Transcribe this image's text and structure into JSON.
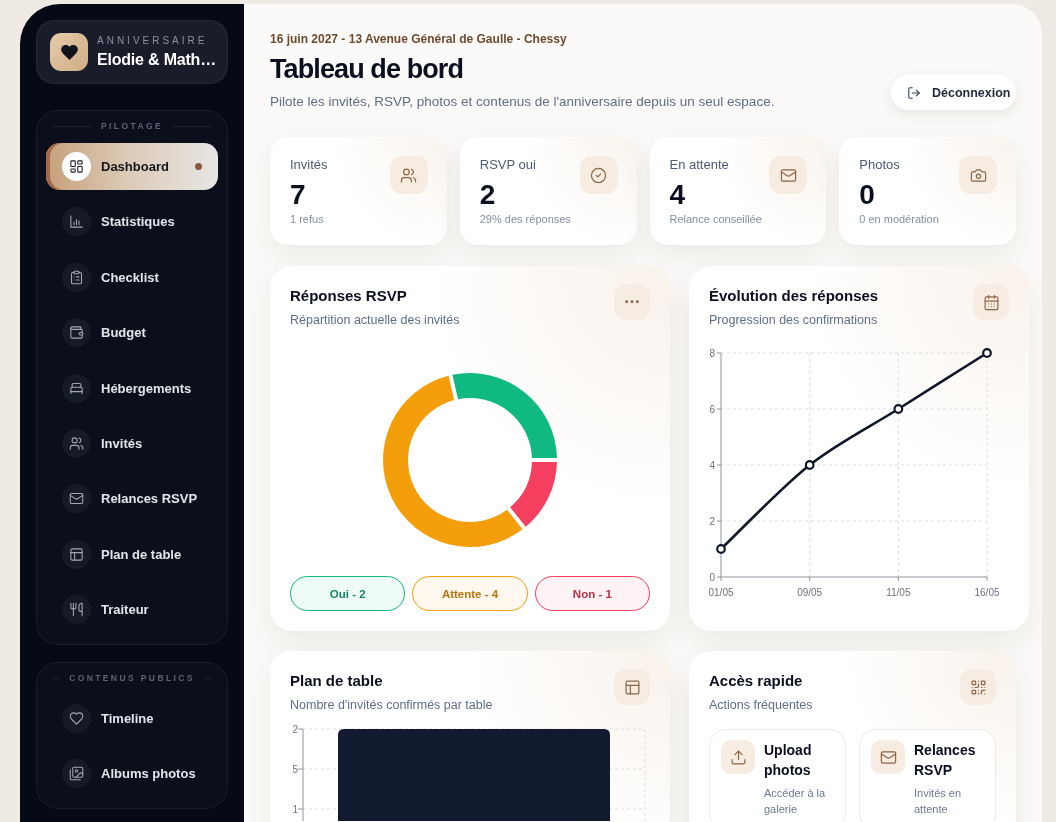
{
  "sidebar": {
    "brand": {
      "eyebrow": "ANNIVERSAIRE",
      "name": "Elodie & Math…"
    },
    "groups": [
      {
        "label": "PILOTAGE",
        "items": [
          {
            "label": "Dashboard",
            "selected": true
          },
          {
            "label": "Statistiques",
            "selected": false
          },
          {
            "label": "Checklist",
            "selected": false
          },
          {
            "label": "Budget",
            "selected": false
          },
          {
            "label": "Hébergements",
            "selected": false
          },
          {
            "label": "Invités",
            "selected": false
          },
          {
            "label": "Relances RSVP",
            "selected": false
          },
          {
            "label": "Plan de table",
            "selected": false
          },
          {
            "label": "Traiteur",
            "selected": false
          }
        ]
      },
      {
        "label": "CONTENUS PUBLICS",
        "items": [
          {
            "label": "Timeline",
            "selected": false
          },
          {
            "label": "Albums photos",
            "selected": false
          }
        ]
      }
    ]
  },
  "header": {
    "eyebrow": "16 juin 2027 - 13 Avenue Général de Gaulle - Chessy",
    "title": "Tableau de bord",
    "subtitle": "Pilote les invités, RSVP, photos et contenus de l'anniversaire depuis un seul espace.",
    "logout_button": "Déconnexion"
  },
  "stats": [
    {
      "label": "Invités",
      "value": "7",
      "note": "1 refus"
    },
    {
      "label": "RSVP oui",
      "value": "2",
      "note": "29% des réponses"
    },
    {
      "label": "En attente",
      "value": "4",
      "note": "Relance conseillée"
    },
    {
      "label": "Photos",
      "value": "0",
      "note": "0 en modération"
    }
  ],
  "rsvp_card": {
    "title": "Réponses RSVP",
    "subtitle": "Répartition actuelle des invités",
    "chart_data": {
      "type": "donut",
      "values": [
        28.6,
        57.1,
        14.3
      ]
    },
    "legend": [
      {
        "label": "Oui - 2",
        "color": "#10b981"
      },
      {
        "label": "Attente - 4",
        "color": "#f59e0b"
      },
      {
        "label": "Non - 1",
        "color": "#f43f5e"
      }
    ]
  },
  "evolution_card": {
    "title": "Évolution des réponses",
    "subtitle": "Progression des confirmations",
    "chart_data": {
      "type": "line",
      "categories": [
        "01/05",
        "09/05",
        "11/05",
        "16/05"
      ],
      "series": [
        {
          "color": "#0f172a",
          "marker": "circle",
          "values": [
            1,
            4,
            6,
            8
          ]
        }
      ],
      "ylim": [
        0,
        8
      ],
      "yticks": [
        0,
        2,
        4,
        6,
        8
      ],
      "grid": true
    }
  },
  "table_card": {
    "title": "Plan de table",
    "subtitle": "Nombre d'invités confirmés par table",
    "y_axis_labels": [
      "2",
      "5",
      "1"
    ]
  },
  "quick_card": {
    "title": "Accès rapide",
    "subtitle": "Actions fréquentes",
    "actions": [
      {
        "title": "Upload photos",
        "note": "Accéder à la galerie"
      },
      {
        "title": "Relances RSVP",
        "note": "Invités en attente"
      }
    ]
  }
}
